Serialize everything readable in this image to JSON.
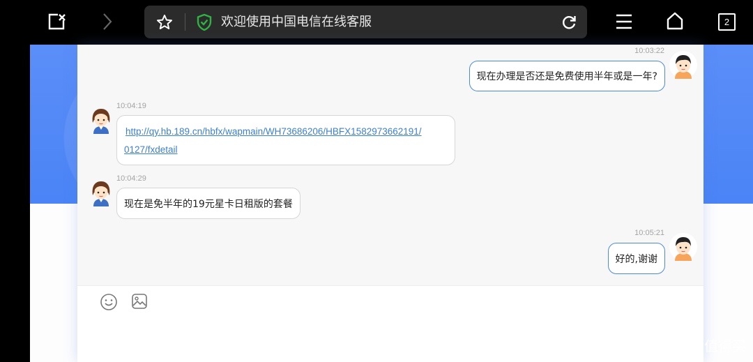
{
  "browser": {
    "page_title": "欢迎使用中国电信在线客服",
    "tab_count": "2",
    "icons": {
      "close_page": "close-page-icon",
      "forward": "chevron-right-icon",
      "bookmark": "star-icon",
      "secure": "shield-check-icon",
      "reload": "reload-icon",
      "menu": "menu-icon",
      "home": "home-icon",
      "tabs": "tabs-icon"
    },
    "colors": {
      "shield": "#2fb344",
      "bar_bg": "#000000",
      "address_bg": "#2b2b2b"
    }
  },
  "chat": {
    "messages": [
      {
        "side": "right",
        "sender": "user",
        "time": "10:03:22",
        "text": "现在办理是否还是免费使用半年或是一年?"
      },
      {
        "side": "left",
        "sender": "agent",
        "time": "10:04:19",
        "link_line1": "http://qy.hb.189.cn/hbfx/wapmain/WH73686206/HBFX1582973662191/",
        "link_line2": "0127/fxdetail"
      },
      {
        "side": "left",
        "sender": "agent",
        "time": "10:04:29",
        "text": "现在是免半年的19元星卡日租版的套餐"
      },
      {
        "side": "right",
        "sender": "user",
        "time": "10:05:21",
        "text": "好的,谢谢"
      }
    ],
    "colors": {
      "user_bubble_border": "#4a8ad8",
      "link": "#3b7fd6",
      "page_blue": "#4a84f6"
    }
  },
  "composer": {
    "icons": {
      "emoji": "emoji-icon",
      "image": "image-icon"
    }
  },
  "watermark": {
    "text": "什么值得买",
    "logo": "值"
  }
}
